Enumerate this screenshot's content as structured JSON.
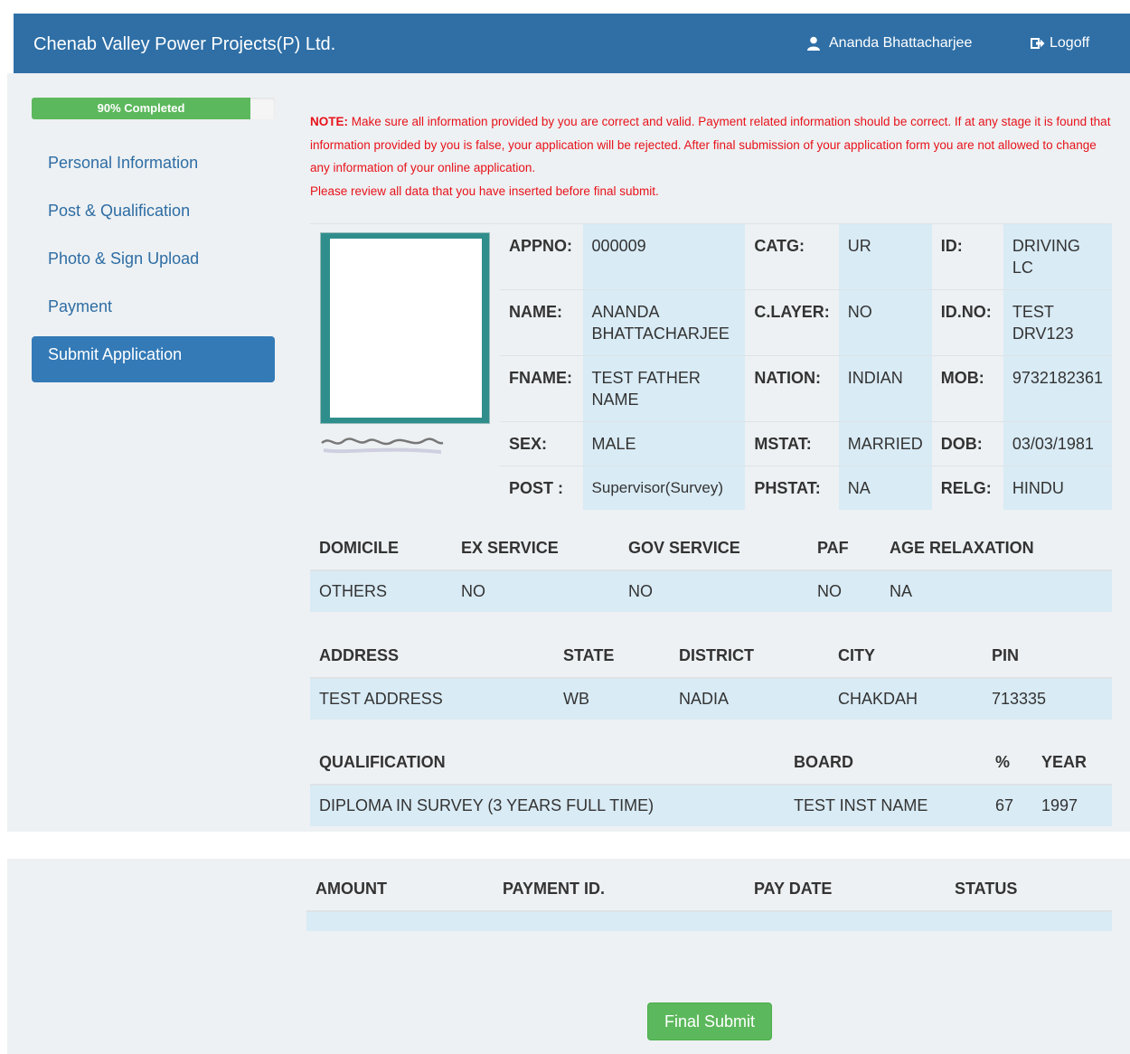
{
  "header": {
    "brand": "Chenab Valley Power Projects(P) Ltd.",
    "user_name": "Ananda Bhattacharjee",
    "logoff_label": "Logoff",
    "background": "#2f6fa6"
  },
  "progress": {
    "label": "90% Completed",
    "value_percent": 90,
    "color": "#5cb85c"
  },
  "sidebar": {
    "items": [
      {
        "label": "Personal Information",
        "active": false
      },
      {
        "label": "Post & Qualification",
        "active": false
      },
      {
        "label": "Photo & Sign Upload",
        "active": false
      },
      {
        "label": "Payment",
        "active": false
      },
      {
        "label": "Submit Application",
        "active": true
      }
    ]
  },
  "note": {
    "prefix": "NOTE:",
    "text": " Make sure all information provided by you are correct and valid. Payment related information should be correct. If at any stage it is found that information provided by you is false, your application will be rejected. After final submission of your application form you are not allowed to change any information of your online application.",
    "review": "Please review all data that you have inserted before final submit.",
    "color": "#e8121a"
  },
  "applicant": {
    "rows": [
      [
        {
          "label": "APPNO:",
          "value": "000009"
        },
        {
          "label": "CATG:",
          "value": "UR"
        },
        {
          "label": "ID:",
          "value": "DRIVING LC"
        }
      ],
      [
        {
          "label": "NAME:",
          "value": "ANANDA BHATTACHARJEE"
        },
        {
          "label": "C.LAYER:",
          "value": "NO"
        },
        {
          "label": "ID.NO:",
          "value": "TEST DRV123"
        }
      ],
      [
        {
          "label": "FNAME:",
          "value": "TEST FATHER NAME"
        },
        {
          "label": "NATION:",
          "value": "INDIAN"
        },
        {
          "label": "MOB:",
          "value": "9732182361"
        }
      ],
      [
        {
          "label": "SEX:",
          "value": "MALE"
        },
        {
          "label": "MSTAT:",
          "value": "MARRIED"
        },
        {
          "label": "DOB:",
          "value": "03/03/1981"
        }
      ],
      [
        {
          "label": "POST :",
          "value": "Supervisor(Survey)"
        },
        {
          "label": "PHSTAT:",
          "value": "NA"
        },
        {
          "label": "RELG:",
          "value": "HINDU"
        }
      ]
    ]
  },
  "domicile_table": {
    "headers": [
      "DOMICILE",
      "EX SERVICE",
      "GOV SERVICE",
      "PAF",
      "AGE RELAXATION"
    ],
    "row": [
      "OTHERS",
      "NO",
      "NO",
      "NO",
      "NA"
    ]
  },
  "address_table": {
    "headers": [
      "ADDRESS",
      "STATE",
      "DISTRICT",
      "CITY",
      "PIN"
    ],
    "row": [
      "TEST ADDRESS",
      "WB",
      "NADIA",
      "CHAKDAH",
      "713335"
    ]
  },
  "qualification_table": {
    "headers": [
      "QUALIFICATION",
      "BOARD",
      "%",
      "YEAR"
    ],
    "row": [
      "DIPLOMA IN SURVEY (3 YEARS FULL TIME)",
      "TEST INST NAME",
      "67",
      "1997"
    ]
  },
  "payment_table": {
    "headers": [
      "AMOUNT",
      "PAYMENT ID.",
      "PAY DATE",
      "STATUS"
    ]
  },
  "final_submit_label": "Final Submit"
}
